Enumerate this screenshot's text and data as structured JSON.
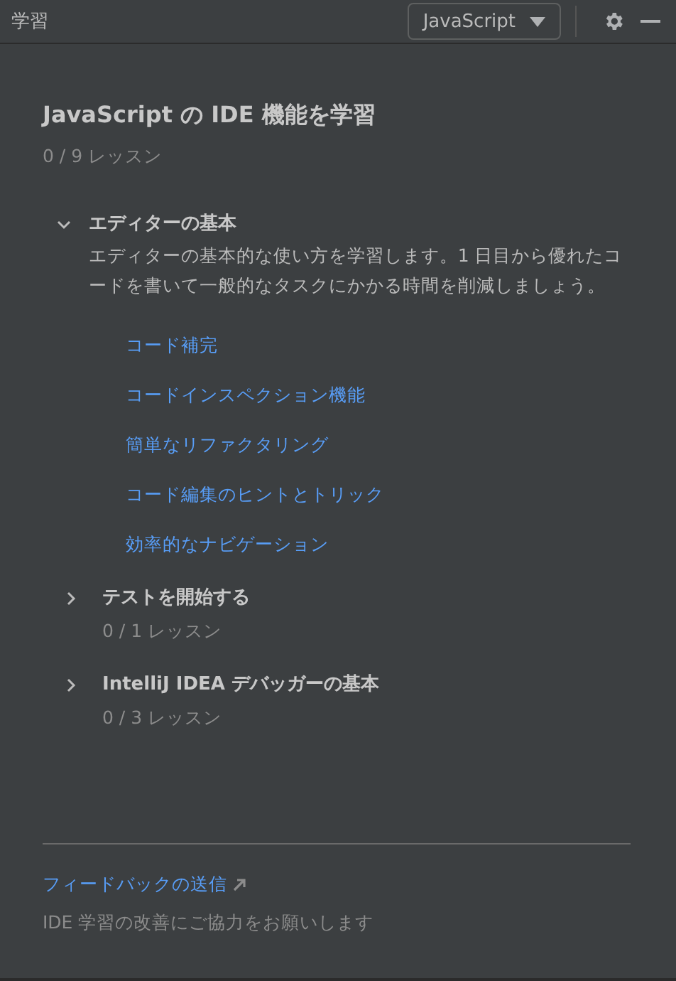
{
  "header": {
    "title": "学習",
    "language": "JavaScript"
  },
  "course": {
    "title": "JavaScript の IDE 機能を学習",
    "progress": "0 / 9 レッスン"
  },
  "modules": [
    {
      "title": "エディターの基本",
      "expanded": true,
      "description": "エディターの基本的な使い方を学習します。1 日目から優れたコードを書いて一般的なタスクにかかる時間を削減しましょう。",
      "lessons": [
        "コード補完",
        "コードインスペクション機能",
        "簡単なリファクタリング",
        "コード編集のヒントとトリック",
        "効率的なナビゲーション"
      ]
    },
    {
      "title": "テストを開始する",
      "expanded": false,
      "progress": "0 / 1 レッスン"
    },
    {
      "title": "IntelliJ IDEA デバッガーの基本",
      "expanded": false,
      "progress": "0 / 3 レッスン"
    }
  ],
  "footer": {
    "link": "フィードバックの送信",
    "note": "IDE 学習の改善にご協力をお願いします"
  }
}
